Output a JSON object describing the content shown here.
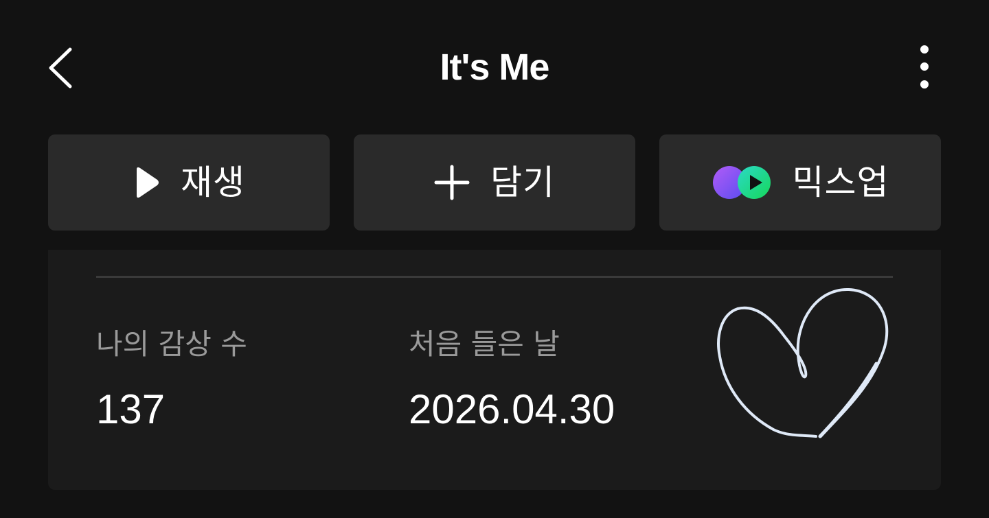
{
  "header": {
    "title": "It's Me",
    "back_icon": "chevron-left-icon",
    "more_icon": "more-vertical-icon"
  },
  "actions": {
    "play": {
      "label": "재생",
      "icon": "play-icon"
    },
    "add": {
      "label": "담기",
      "icon": "plus-icon"
    },
    "mixup": {
      "label": "믹스업",
      "icon": "mixup-icon"
    }
  },
  "stats": {
    "listen_count": {
      "label": "나의 감상 수",
      "value": "137"
    },
    "first_listened": {
      "label": "처음 들은 날",
      "value": "2026.04.30"
    }
  },
  "decoration": {
    "icon": "heart-drawing-icon"
  },
  "colors": {
    "background": "#121212",
    "button_bg": "#2a2a2a",
    "card_bg": "#1b1b1b",
    "label_gray": "#9a9a9a",
    "mixup_purple": "#8b5cf6",
    "mixup_green": "#19d66a",
    "heart_stroke": "#dfe9f7"
  }
}
